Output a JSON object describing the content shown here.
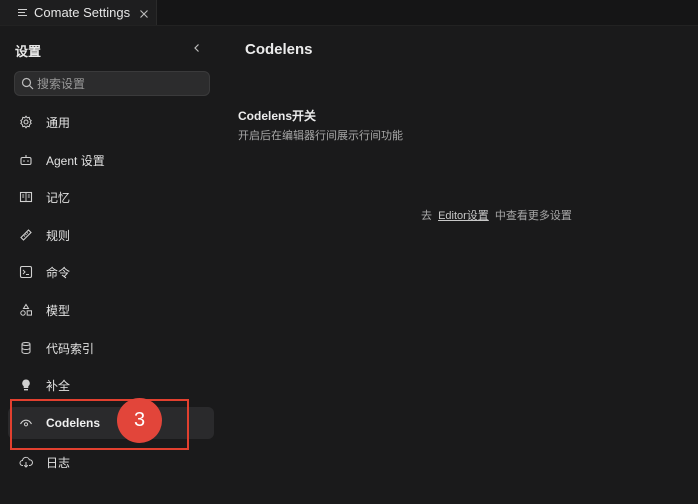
{
  "tab": {
    "title": "Comate Settings",
    "icon": "list-icon"
  },
  "sidebar": {
    "title": "设置",
    "search_placeholder": "搜索设置",
    "items": [
      {
        "label": "通用",
        "icon": "gear-icon"
      },
      {
        "label": "Agent 设置",
        "icon": "robot-icon"
      },
      {
        "label": "记忆",
        "icon": "book-icon"
      },
      {
        "label": "规则",
        "icon": "ruler-icon"
      },
      {
        "label": "命令",
        "icon": "terminal-icon"
      },
      {
        "label": "模型",
        "icon": "shapes-icon"
      },
      {
        "label": "代码索引",
        "icon": "database-icon"
      },
      {
        "label": "补全",
        "icon": "lightbulb-icon"
      },
      {
        "label": "Codelens",
        "icon": "eye-icon",
        "active": true
      },
      {
        "label": "日志",
        "icon": "cloud-download-icon"
      }
    ]
  },
  "annotation": {
    "step": "3",
    "color": "#e2453a"
  },
  "main": {
    "title": "Codelens",
    "section_title": "Codelens开关",
    "section_desc": "开启后在编辑器行间展示行间功能",
    "hint_prefix": "去",
    "hint_link": "Editor设置",
    "hint_suffix": "中查看更多设置"
  },
  "colors": {
    "background": "#1a1a1b",
    "active_item": "#2a2a2c",
    "annotation_red": "#e2402f"
  }
}
